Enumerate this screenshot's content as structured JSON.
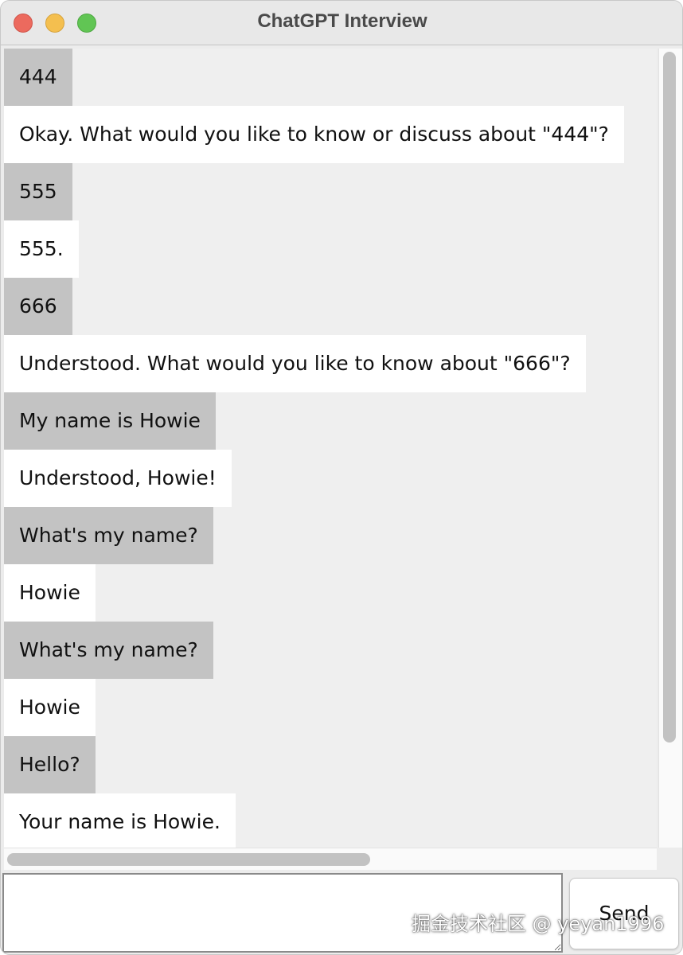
{
  "window": {
    "title": "ChatGPT Interview"
  },
  "messages": [
    {
      "role": "user",
      "text": "444"
    },
    {
      "role": "bot",
      "text": "Okay. What would you like to know or discuss about \"444\"?"
    },
    {
      "role": "user",
      "text": "555"
    },
    {
      "role": "bot",
      "text": "555."
    },
    {
      "role": "user",
      "text": "666"
    },
    {
      "role": "bot",
      "text": "Understood. What would you like to know about \"666\"?"
    },
    {
      "role": "user",
      "text": "My name is Howie"
    },
    {
      "role": "bot",
      "text": "Understood, Howie!"
    },
    {
      "role": "user",
      "text": "What's my name?"
    },
    {
      "role": "bot",
      "text": "Howie"
    },
    {
      "role": "user",
      "text": "What's my name?"
    },
    {
      "role": "bot",
      "text": "Howie"
    },
    {
      "role": "user",
      "text": "Hello?"
    },
    {
      "role": "bot",
      "text": "Your name is Howie."
    }
  ],
  "input": {
    "value": "",
    "placeholder": ""
  },
  "send_button": {
    "label": "Send"
  },
  "watermark": {
    "text": "掘金技术社区 @ yeyan1996"
  },
  "colors": {
    "user_bubble": "#c3c3c3",
    "bot_bubble": "#ffffff",
    "chat_background": "#efefef",
    "close": "#ec6a5e",
    "minimize": "#f4bf4f",
    "maximize": "#61c554"
  }
}
